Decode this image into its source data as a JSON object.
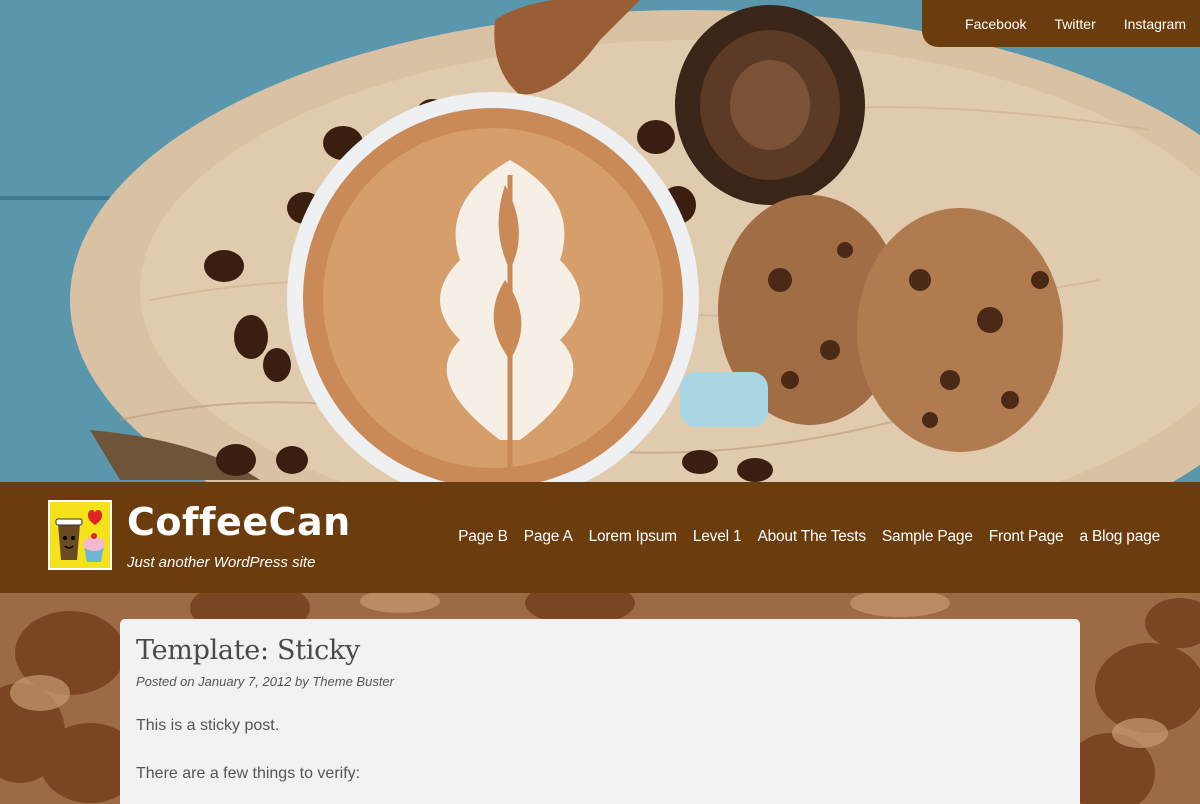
{
  "social": {
    "links": [
      "Facebook",
      "Twitter",
      "Instagram"
    ]
  },
  "site": {
    "title": "CoffeeCan",
    "tagline": "Just another WordPress site"
  },
  "nav": {
    "items": [
      "Page B",
      "Page A",
      "Lorem Ipsum",
      "Level 1",
      "About The Tests",
      "Sample Page",
      "Front Page",
      "a Blog page"
    ]
  },
  "post": {
    "title": "Template: Sticky",
    "meta": "Posted on January 7, 2012 by Theme Buster",
    "paragraphs": [
      "This is a sticky post.",
      "There are a few things to verify:"
    ]
  },
  "colors": {
    "brand_brown": "#6b3c0d",
    "card_bg": "#f2f2f2"
  }
}
